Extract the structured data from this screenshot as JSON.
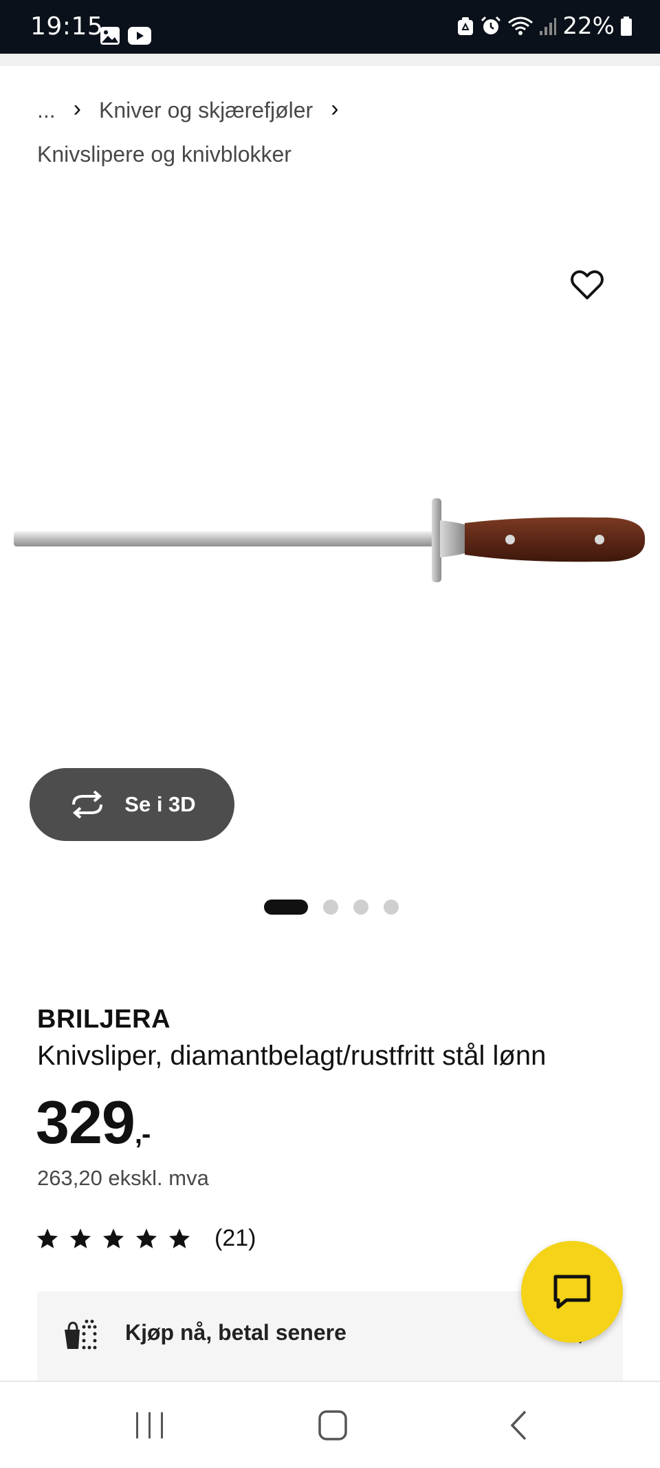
{
  "status_bar": {
    "time": "19:15",
    "battery": "22%",
    "icons": [
      "gallery-icon",
      "youtube-icon",
      "recycle-icon",
      "alarm-icon",
      "wifi-icon",
      "signal-icon",
      "battery-icon"
    ]
  },
  "breadcrumb": {
    "ellipsis": "...",
    "items": [
      "Kniver og skjærefjøler",
      "Knivslipere og knivblokker"
    ]
  },
  "product": {
    "brand": "BRILJERA",
    "description": "Knivsliper, diamantbelagt/rustfritt stål lønn",
    "price": "329",
    "price_suffix": ",-",
    "price_ex_vat": "263,20 ekskl. mva",
    "rating": 5,
    "rating_count": "(21)"
  },
  "gallery": {
    "view_3d_label": "Se i 3D",
    "image_count": 4,
    "active_index": 0
  },
  "payment": {
    "label": "Kjøp nå, betal senere"
  },
  "colors": {
    "status_bar_bg": "#0b111a",
    "chat_button": "#f4d318",
    "view_3d_button": "#4d4d4d",
    "dot_active": "#111111",
    "dot_inactive": "#cfcfcf"
  }
}
